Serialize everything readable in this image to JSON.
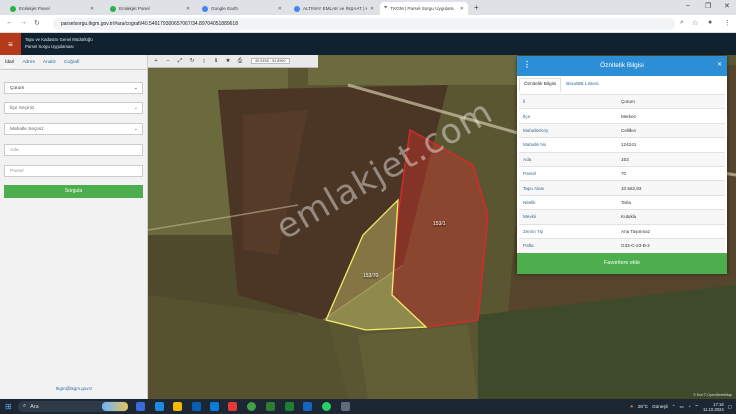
{
  "browser": {
    "tabs": [
      {
        "title": "Emlakjet Panel",
        "color": "#2bb14a",
        "active": false
      },
      {
        "title": "Emlakjet Panel",
        "color": "#2bb14a",
        "active": false
      },
      {
        "title": "Google Earth",
        "color": "#4285f4",
        "active": false
      },
      {
        "title": "ALTINAY EMLAK ve İNŞAAT | Ka",
        "color": "#4285f4",
        "active": false
      },
      {
        "title": "TKGM | Parsel Sorgu Uygulama",
        "color": "#333333",
        "active": true
      }
    ],
    "url": "parselsorgu.tkgm.gov.tr/#ara/cografi/40.546179300657067/34.89704051889618"
  },
  "app": {
    "header_line1": "Tapu ve Kadastro Genel Müdürlüğü",
    "header_line2": "Parsel Sorgu Uygulaması"
  },
  "sidebar": {
    "tabs": [
      "İdari",
      "Adres",
      "Analiz",
      "Coğrafi"
    ],
    "province": "Çorum",
    "district_placeholder": "İlçe Seçiniz",
    "neighborhood_placeholder": "Mahalle Seçiniz",
    "ada_placeholder": "Ada",
    "parsel_placeholder": "Parsel",
    "query_button": "Sorgula",
    "email": "tkgm@tkgm.gov.tr"
  },
  "map": {
    "coords": "40.5458 : 34.8969",
    "watermark": "emlakjet.com",
    "parcel_labels": [
      "153/70",
      "153/1"
    ],
    "attribution": "© Esri © OpenStreetMap"
  },
  "panel": {
    "title": "Öznitelik Bilgisi",
    "tabs": [
      "Öznitelik Bilgisi",
      "Bina/BB Listesi"
    ],
    "rows": [
      {
        "key": "İl",
        "value": "Çorum"
      },
      {
        "key": "İlçe",
        "value": "Merkez"
      },
      {
        "key": "Mahalle/Köy",
        "value": "Celilkırı"
      },
      {
        "key": "Mahalle No",
        "value": "124241"
      },
      {
        "key": "Ada",
        "value": "153"
      },
      {
        "key": "Parsel",
        "value": "70"
      },
      {
        "key": "Tapu Alanı",
        "value": "10.562,83"
      },
      {
        "key": "Nitelik",
        "value": "Tarla"
      },
      {
        "key": "Mevkii",
        "value": "Kutuklu"
      },
      {
        "key": "Zemin Tip",
        "value": "Ana Taşınmaz"
      },
      {
        "key": "Pafta",
        "value": "G33-C-23-B-2"
      }
    ],
    "favorite_button": "Favorilere ekle"
  },
  "taskbar": {
    "search": "Ara",
    "weather": "26°C",
    "weather_text": "Güneşli",
    "time": "17:16",
    "date": "11.10.2024"
  }
}
